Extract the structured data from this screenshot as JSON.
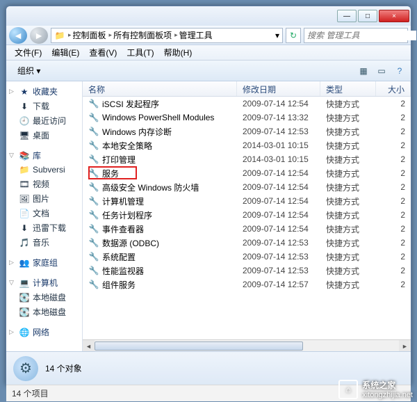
{
  "window": {
    "min": "—",
    "max": "□",
    "close": "×"
  },
  "breadcrumb": {
    "items": [
      {
        "label": "控制面板"
      },
      {
        "label": "所有控制面板项"
      },
      {
        "label": "管理工具"
      }
    ]
  },
  "search": {
    "placeholder": "搜索 管理工具"
  },
  "menu": {
    "file": "文件(F)",
    "edit": "编辑(E)",
    "view": "查看(V)",
    "tools": "工具(T)",
    "help": "帮助(H)"
  },
  "toolbar": {
    "organize": "组织 ▾"
  },
  "sidebar": {
    "favorites": {
      "header": "收藏夹",
      "items": [
        "下载",
        "最近访问",
        "桌面"
      ]
    },
    "libraries": {
      "header": "库",
      "items": [
        "Subversi",
        "视频",
        "图片",
        "文档",
        "迅雷下载",
        "音乐"
      ]
    },
    "homegroup": {
      "header": "家庭组"
    },
    "computer": {
      "header": "计算机",
      "items": [
        "本地磁盘",
        "本地磁盘"
      ]
    },
    "network": {
      "header": "网络"
    }
  },
  "columns": {
    "name": "名称",
    "date": "修改日期",
    "type": "类型",
    "size": "大小"
  },
  "files": [
    {
      "name": "iSCSI 发起程序",
      "date": "2009-07-14 12:54",
      "type": "快捷方式",
      "size": "2"
    },
    {
      "name": "Windows PowerShell Modules",
      "date": "2009-07-14 13:32",
      "type": "快捷方式",
      "size": "2"
    },
    {
      "name": "Windows 内存诊断",
      "date": "2009-07-14 12:53",
      "type": "快捷方式",
      "size": "2"
    },
    {
      "name": "本地安全策略",
      "date": "2014-03-01 10:15",
      "type": "快捷方式",
      "size": "2"
    },
    {
      "name": "打印管理",
      "date": "2014-03-01 10:15",
      "type": "快捷方式",
      "size": "2"
    },
    {
      "name": "服务",
      "date": "2009-07-14 12:54",
      "type": "快捷方式",
      "size": "2"
    },
    {
      "name": "高级安全 Windows 防火墙",
      "date": "2009-07-14 12:54",
      "type": "快捷方式",
      "size": "2"
    },
    {
      "name": "计算机管理",
      "date": "2009-07-14 12:54",
      "type": "快捷方式",
      "size": "2"
    },
    {
      "name": "任务计划程序",
      "date": "2009-07-14 12:54",
      "type": "快捷方式",
      "size": "2"
    },
    {
      "name": "事件查看器",
      "date": "2009-07-14 12:54",
      "type": "快捷方式",
      "size": "2"
    },
    {
      "name": "数据源 (ODBC)",
      "date": "2009-07-14 12:53",
      "type": "快捷方式",
      "size": "2"
    },
    {
      "name": "系统配置",
      "date": "2009-07-14 12:53",
      "type": "快捷方式",
      "size": "2"
    },
    {
      "name": "性能监视器",
      "date": "2009-07-14 12:53",
      "type": "快捷方式",
      "size": "2"
    },
    {
      "name": "组件服务",
      "date": "2009-07-14 12:57",
      "type": "快捷方式",
      "size": "2"
    }
  ],
  "details": {
    "count": "14 个对象"
  },
  "status": {
    "items": "14 个项目"
  },
  "watermark": {
    "name": "系统之家",
    "url": "xitongzhijia.net"
  }
}
